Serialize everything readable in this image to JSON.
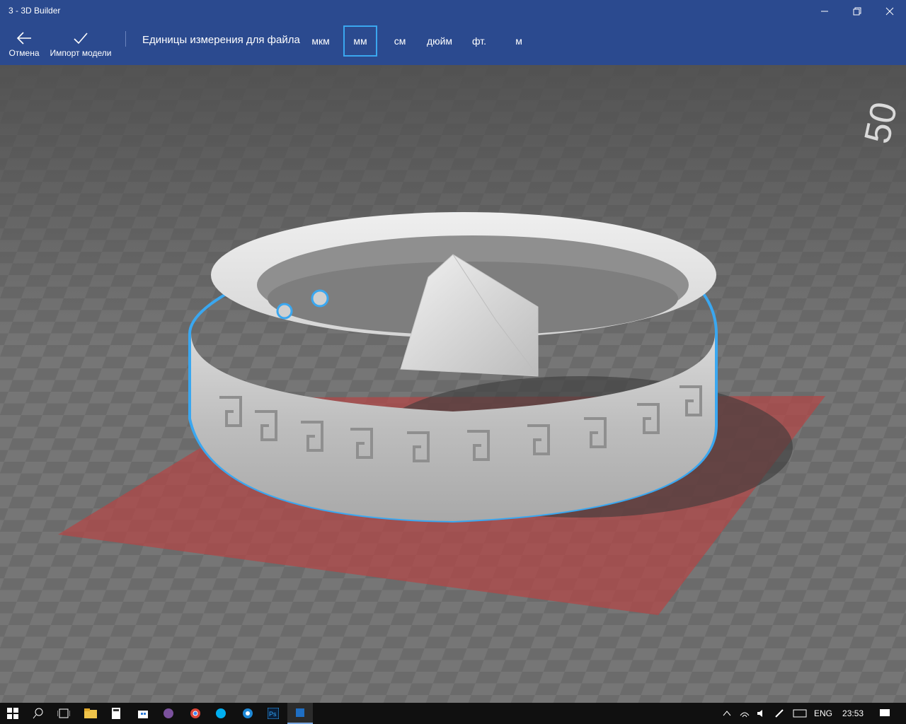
{
  "window": {
    "title": "3 - 3D Builder",
    "minimize_icon": "minimize-icon",
    "restore_icon": "restore-icon",
    "close_icon": "close-icon"
  },
  "toolbar": {
    "cancel_label": "Отмена",
    "import_label": "Импорт модели",
    "units_label": "Единицы измерения для файла",
    "units": [
      "мкм",
      "мм",
      "см",
      "дюйм",
      "фт.",
      "м"
    ],
    "selected_unit": "мм",
    "accent_color": "#3aa7f0"
  },
  "viewport": {
    "grid_number": "50"
  },
  "taskbar": {
    "language": "ENG",
    "time": "23:53",
    "icons": [
      "windows-start-icon",
      "search-icon",
      "task-view-icon",
      "file-explorer-icon",
      "calculator-icon",
      "store-icon",
      "viber-icon",
      "chrome-icon",
      "skype-icon",
      "app-icon",
      "photoshop-icon",
      "3d-builder-icon"
    ],
    "ps_label": "Ps"
  }
}
